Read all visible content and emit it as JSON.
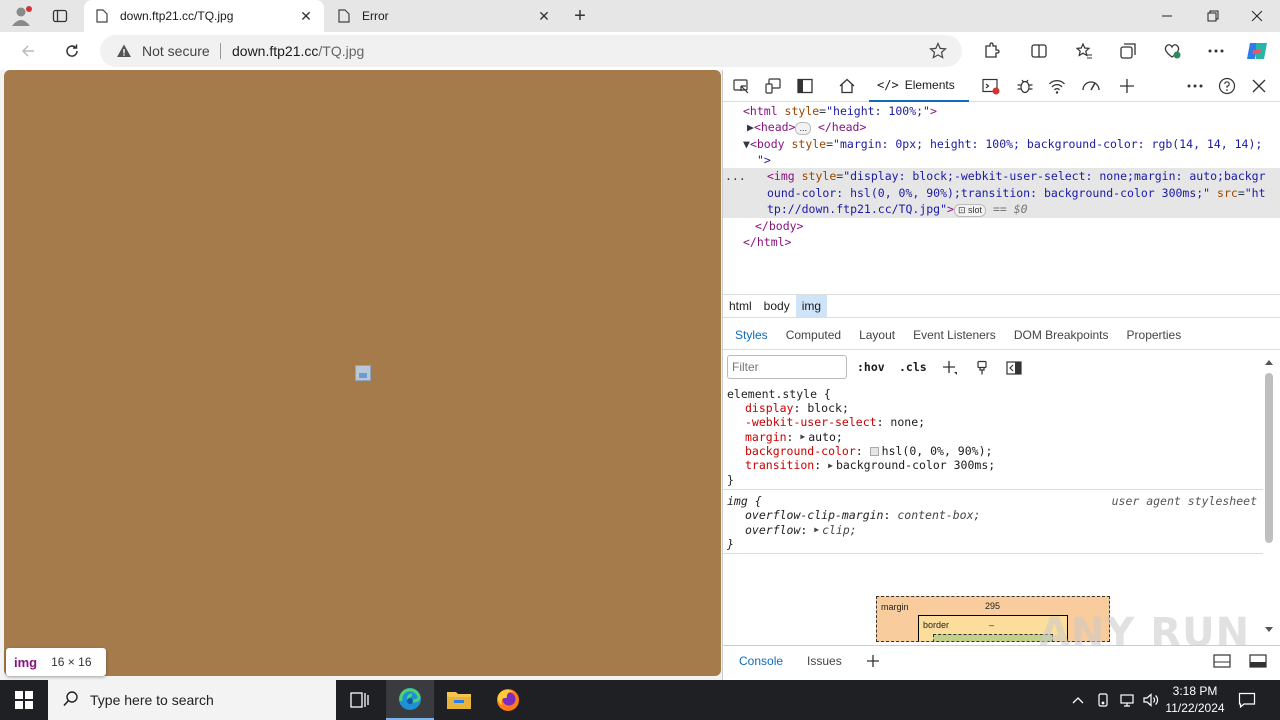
{
  "browser": {
    "tabs": [
      {
        "title": "down.ftp21.cc/TQ.jpg",
        "active": true
      },
      {
        "title": "Error",
        "active": false
      }
    ],
    "address": {
      "security_label": "Not secure",
      "host": "down.ftp21.cc",
      "path": "/TQ.jpg"
    }
  },
  "viewport": {
    "background": "#a57b4c",
    "hover_tooltip": {
      "tag": "img",
      "size": "16 × 16"
    }
  },
  "devtools": {
    "active_tab": "Elements",
    "dom": {
      "line1": {
        "tag_open": "<html",
        "attr": " style",
        "eq": "=",
        "val": "\"height: 100%;\"",
        "tag_close": ">"
      },
      "line2": {
        "a": "<head>",
        "b": "</head>"
      },
      "line3": {
        "tag_open": "<body",
        "attr": " style",
        "eq": "=",
        "val": "\"margin: 0px; height: 100%; background-color: rgb(14, 14, 14);"
      },
      "line4": "\">",
      "img_l1": {
        "tag_open": "<img",
        "attr": " style",
        "eq": "=",
        "val": "\"display: block;-webkit-user-select: none;margin: auto;backgr"
      },
      "img_l2": {
        "val": "ound-color: hsl(0, 0%, 90%);transition: background-color 300ms;\"",
        "attr": " src",
        "eq": "=",
        "val2": "\"ht"
      },
      "img_l3": {
        "val": "tp://down.ftp21.cc/TQ.jpg\"",
        "tag_close": ">",
        "badge": "slot",
        "ref": "== $0"
      },
      "line_body_close": "</body>",
      "line_html_close": "</html>",
      "ellipsis": "..."
    },
    "breadcrumbs": [
      "html",
      "body",
      "img"
    ],
    "subtabs": [
      "Styles",
      "Computed",
      "Layout",
      "Event Listeners",
      "DOM Breakpoints",
      "Properties"
    ],
    "filter_placeholder": "Filter",
    "hov": ":hov",
    "cls": ".cls",
    "rules": {
      "element_style": {
        "selector": "element.style {",
        "props": [
          {
            "name": "display",
            "value": "block;"
          },
          {
            "name": "-webkit-user-select",
            "value": "none;"
          },
          {
            "name": "margin",
            "value": "auto;"
          },
          {
            "name": "background-color",
            "value": "hsl(0, 0%, 90%);"
          },
          {
            "name": "transition",
            "value": "background-color 300ms;"
          }
        ],
        "close": "}"
      },
      "ua_img": {
        "selector": "img {",
        "source": "user agent stylesheet",
        "props": [
          {
            "name": "overflow-clip-margin",
            "value": "content-box;"
          },
          {
            "name": "overflow",
            "value": "clip;"
          }
        ],
        "close": "}"
      }
    },
    "box_model": {
      "margin_label": "margin",
      "margin_top": "295",
      "border_label": "border",
      "border_top": "–"
    },
    "drawer_tabs": [
      "Console",
      "Issues"
    ]
  },
  "watermark": "ANY RUN",
  "taskbar": {
    "search_placeholder": "Type here to search",
    "time": "3:18 PM",
    "date": "11/22/2024"
  }
}
